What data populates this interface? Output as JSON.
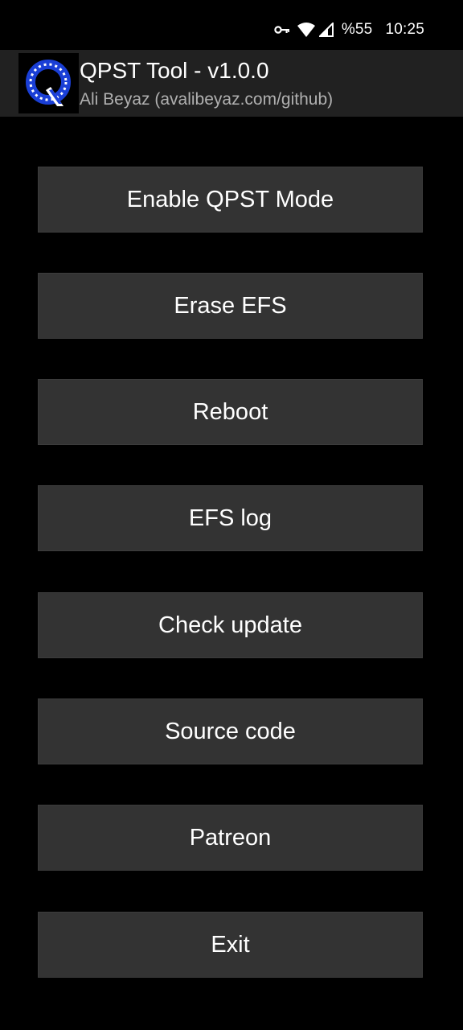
{
  "status_bar": {
    "battery": "%55",
    "time": "10:25",
    "icons": [
      "vpn-key-icon",
      "wifi-icon",
      "cell-signal-icon"
    ]
  },
  "header": {
    "logo_letter": "Q",
    "title": "QPST Tool - v1.0.0",
    "subtitle": "Ali Beyaz (avalibeyaz.com/github)"
  },
  "buttons": [
    {
      "label": "Enable QPST Mode"
    },
    {
      "label": "Erase EFS"
    },
    {
      "label": "Reboot"
    },
    {
      "label": "EFS log"
    },
    {
      "label": "Check update"
    },
    {
      "label": "Source code"
    },
    {
      "label": "Patreon"
    },
    {
      "label": "Exit"
    }
  ],
  "colors": {
    "background": "#000000",
    "header_background": "#212121",
    "button_background": "#333333",
    "logo_blue": "#1a3fd6"
  }
}
